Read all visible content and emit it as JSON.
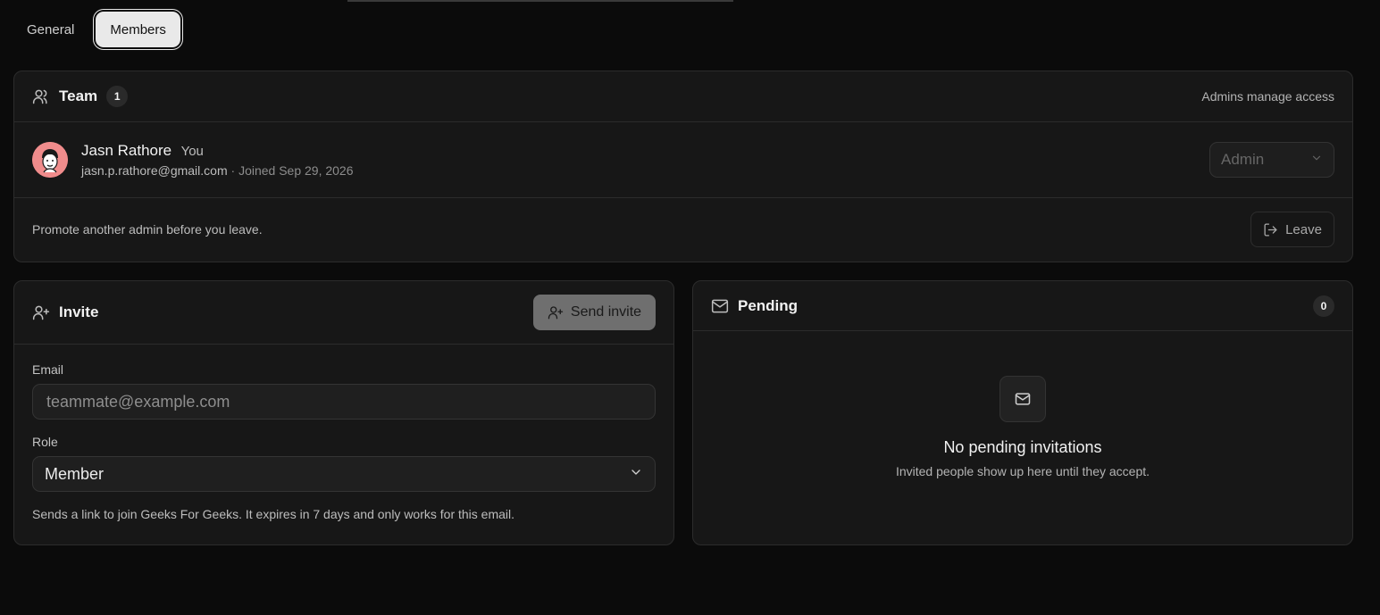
{
  "tabs": [
    {
      "label": "General",
      "active": false
    },
    {
      "label": "Members",
      "active": true
    }
  ],
  "team": {
    "title": "Team",
    "count": "1",
    "note": "Admins manage access",
    "member": {
      "name": "Jasn Rathore",
      "you_tag": "You",
      "email": "jasn.p.rathore@gmail.com",
      "joined": " · Joined Sep 29, 2026",
      "role": "Admin"
    },
    "leave_hint": "Promote another admin before you leave.",
    "leave_label": "Leave"
  },
  "invite": {
    "title": "Invite",
    "send_label": "Send invite",
    "email_label": "Email",
    "email_placeholder": "teammate@example.com",
    "role_label": "Role",
    "role_value": "Member",
    "hint": "Sends a link to join Geeks For Geeks. It expires in 7 days and only works for this email."
  },
  "pending": {
    "title": "Pending",
    "count": "0",
    "empty_title": "No pending invitations",
    "empty_sub": "Invited people show up here until they accept."
  },
  "icons": {
    "team": "users-icon",
    "invite": "user-plus-icon",
    "pending": "mail-icon",
    "leave": "log-out-icon",
    "chevron": "chevron-down-icon"
  },
  "colors": {
    "background": "#0b0b0b",
    "card": "#171717",
    "avatar": "#f08c8c",
    "primary_button_disabled": "#6f6f6f"
  }
}
